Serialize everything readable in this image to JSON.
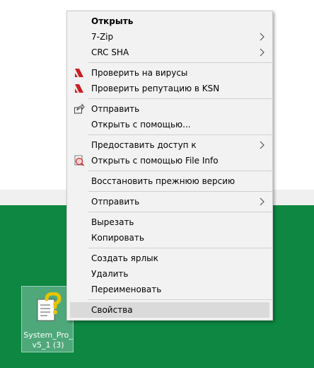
{
  "menu": {
    "items": [
      {
        "label": "Открыть",
        "bold": true
      },
      {
        "label": "7-Zip",
        "submenu": true
      },
      {
        "label": "CRC SHA",
        "submenu": true
      },
      {
        "label": "Проверить на вирусы",
        "icon": "kaspersky-icon"
      },
      {
        "label": "Проверить репутацию в KSN",
        "icon": "kaspersky-icon"
      },
      {
        "label": "Отправить",
        "icon": "share-icon"
      },
      {
        "label": "Открыть с помощью..."
      },
      {
        "label": "Предоставить доступ к",
        "submenu": true
      },
      {
        "label": "Открыть с помощью File Info",
        "icon": "file-info-icon"
      },
      {
        "label": "Восстановить прежнюю версию"
      },
      {
        "label": "Отправить",
        "submenu": true
      },
      {
        "label": "Вырезать"
      },
      {
        "label": "Копировать"
      },
      {
        "label": "Создать ярлык"
      },
      {
        "label": "Удалить"
      },
      {
        "label": "Переименовать"
      },
      {
        "label": "Свойства",
        "highlighted": true
      }
    ]
  },
  "desktop": {
    "icon_label": "System_Pro_v5_1 (3)",
    "icon": "help-file-icon"
  },
  "colors": {
    "desktop_bg": "#0d8741",
    "menu_bg": "#f2f2f2",
    "highlight": "#dadada",
    "kaspersky": "#cc1f24"
  }
}
